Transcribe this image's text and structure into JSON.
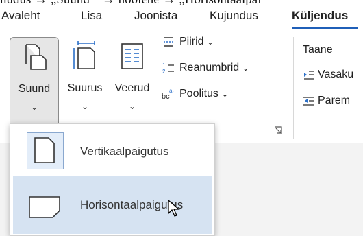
{
  "breadcrumb": "nudus → „Suund “ → hoolene → „Horisontaalpai",
  "tabs": [
    {
      "label": "Avaleht"
    },
    {
      "label": "Lisa"
    },
    {
      "label": "Joonista"
    },
    {
      "label": "Kujundus"
    },
    {
      "label": "Küljendus",
      "active": true
    }
  ],
  "ribbon": {
    "suund": {
      "label": "Suund",
      "icon": "orientation-icon",
      "chevron": "⌄"
    },
    "suurus": {
      "label": "Suurus",
      "icon": "page-size-icon",
      "chevron": "⌄"
    },
    "veerud": {
      "label": "Veerud",
      "icon": "columns-icon",
      "chevron": "⌄"
    },
    "piirid": {
      "label": "Piirid",
      "icon": "breaks-icon",
      "chevron": "⌄"
    },
    "reanumbrid": {
      "label": "Reanumbrid",
      "icon": "line-numbers-icon",
      "chevron": "⌄"
    },
    "poolitus": {
      "label": "Poolitus",
      "icon": "hyphenation-icon",
      "chevron": "⌄"
    },
    "taane": {
      "label": "Taane"
    },
    "vasak": {
      "label": "Vasaku",
      "icon": "indent-left-icon"
    },
    "parem": {
      "label": "Parem",
      "icon": "indent-right-icon"
    }
  },
  "dropdown": {
    "items": [
      {
        "label": "Vertikaalpaigutus",
        "icon": "portrait-page-icon",
        "selected": true
      },
      {
        "label": "Horisontaalpaigutus",
        "icon": "landscape-page-icon",
        "hovered": true
      }
    ]
  },
  "colors": {
    "accent": "#1f5fb8",
    "hover": "#d6e3f2",
    "iconBlue": "#2b6fc8"
  }
}
